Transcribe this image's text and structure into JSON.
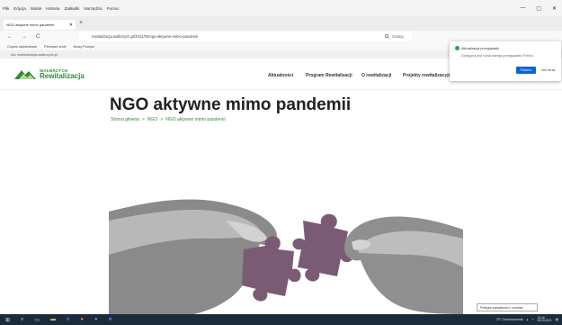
{
  "menubar": {
    "items": [
      "Plik",
      "Edycja",
      "Widok",
      "Historia",
      "Zakładki",
      "Narzędzia",
      "Pomoc"
    ],
    "window_controls": [
      "—",
      "▢",
      "✕"
    ]
  },
  "tab": {
    "title": "NGO aktywne mimo pandemii",
    "close": "✕",
    "new_tab": "+"
  },
  "nav": {
    "back": "←",
    "forward": "→",
    "reload": "C",
    "url": "rewitalizacja.walbrzych.pl/2021/03/ngo-aktywne-mimo-pandemii",
    "search_placeholder": "Szukaj"
  },
  "bookmarks": [
    "Często odwiedzane",
    "Pierwsze kroki",
    "Nowy Pomysł"
  ],
  "infobar": "Ad: rewitalizacja.walbrzych.pl",
  "site": {
    "logo_top": "WAŁBRZYCH",
    "logo_bottom": "Rewitalizacja",
    "nav_items": [
      "Aktualności",
      "Program Rewitalizacji",
      "O rewitalizacji",
      "Projekty rewitalizacyjne"
    ],
    "brand_color": "#2e8b3a"
  },
  "popup": {
    "title": "Aktualizacja przeglądarki",
    "body": "Dostępna jest nowa wersja przeglądarki Firefox.",
    "primary": "Pobierz",
    "secondary": "Nie teraz"
  },
  "page": {
    "title": "NGO aktywne mimo pandemii",
    "breadcrumb": [
      "Strona główna",
      "NGO",
      "NGO aktywne mimo pandemii"
    ],
    "breadcrumb_sep": ">"
  },
  "tooltip": "Polityka prywatności i cookies",
  "taskbar": {
    "icons": [
      "windows-icon",
      "search-icon",
      "task-view-icon",
      "explorer-icon",
      "edge-icon",
      "firefox-icon",
      "app-icon",
      "app-icon-2"
    ],
    "tray_temp": "3°C Zachmurzenie",
    "time": "13:40",
    "date": "09.03.2021"
  }
}
